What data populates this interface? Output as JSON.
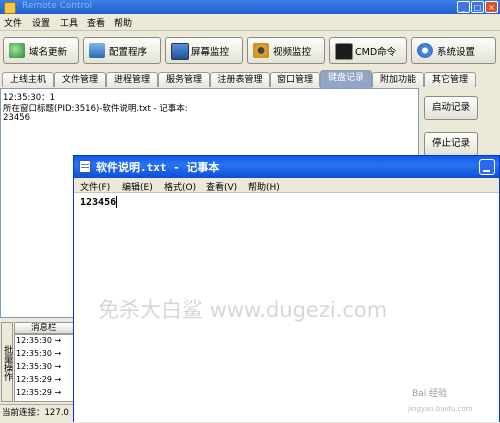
{
  "main_window": {
    "menu": [
      "文件",
      "设置",
      "工具",
      "查看",
      "帮助"
    ],
    "toolbar": [
      {
        "label": "域名更新",
        "icon": "globe-icon"
      },
      {
        "label": "配置程序",
        "icon": "config-icon"
      },
      {
        "label": "屏幕监控",
        "icon": "monitor-icon"
      },
      {
        "label": "视频监控",
        "icon": "camera-icon"
      },
      {
        "label": "CMD命令",
        "icon": "cmd-icon"
      },
      {
        "label": "系统设置",
        "icon": "gear-icon"
      }
    ],
    "tabs": [
      "上线主机",
      "文件管理",
      "进程管理",
      "服务管理",
      "注册表管理",
      "窗口管理",
      "键盘记录",
      "附加功能",
      "其它管理"
    ],
    "active_tab": "键盘记录",
    "log_lines": [
      "12:35:30：1",
      "所在窗口标题(PID:3516)-软件说明.txt - 记事本:",
      "23456"
    ],
    "side_buttons": {
      "start": "启动记录",
      "stop": "停止记录"
    },
    "message_panel": {
      "vertical_label": "批量操作",
      "header": "消息栏",
      "rows": [
        "12:35:30 →",
        "12:35:30 →",
        "12:35:30 →",
        "12:35:29 →",
        "12:35:29 →"
      ]
    },
    "status_text": "当前连接：127.0"
  },
  "notepad": {
    "title": "软件说明.txt - 记事本",
    "menu": [
      "文件(F)",
      "编辑(E)",
      "格式(O)",
      "查看(V)",
      "帮助(H)"
    ],
    "content": "123456"
  },
  "watermark": {
    "text": "免杀大白鲨 www.dugezi.com",
    "baidu": "Bai 经验",
    "baidu_url": "jingyan.baidu.com"
  },
  "colors": {
    "xp_title_blue": "#0a5ee8",
    "active_tab": "#8fa6c8",
    "window_face": "#ece9d8"
  }
}
